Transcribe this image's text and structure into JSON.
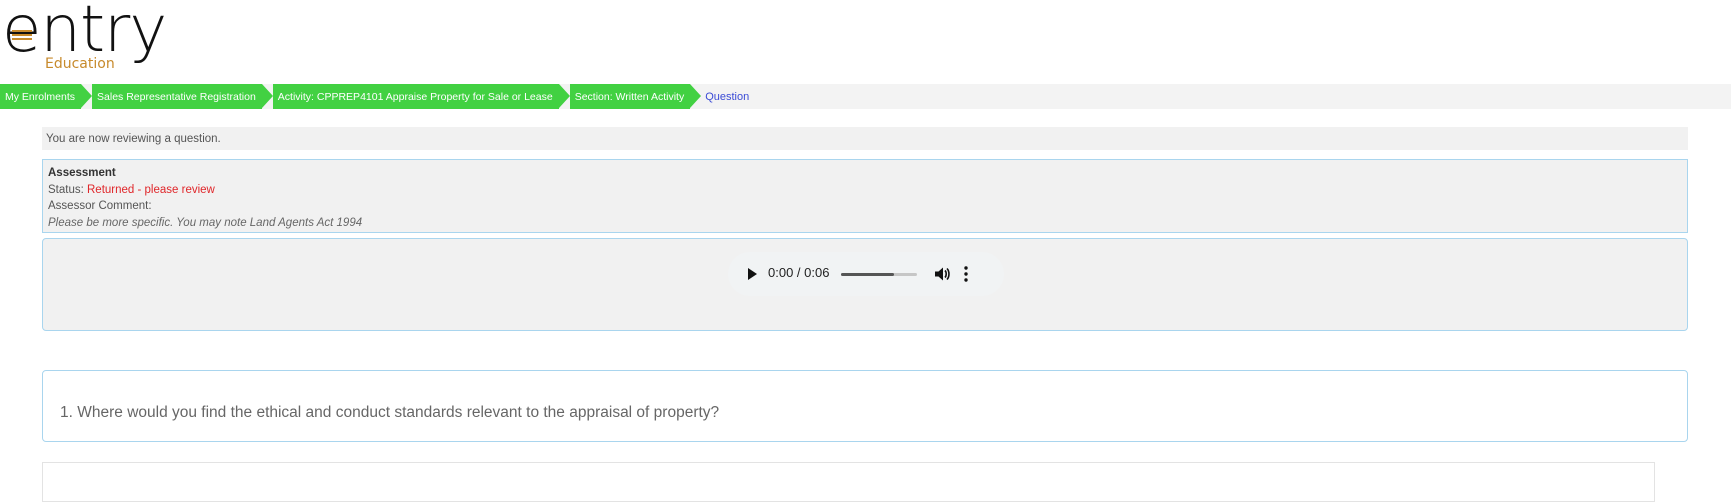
{
  "logo": {
    "word": "entry",
    "sub": "Education"
  },
  "breadcrumb": {
    "items": [
      "My Enrolments",
      "Sales Representative Registration",
      "Activity: CPPREP4101 Appraise Property for Sale or Lease",
      "Section: Written Activity"
    ],
    "current": "Question"
  },
  "notice": "You are now reviewing a question.",
  "assessment": {
    "heading": "Assessment",
    "status_label": "Status: ",
    "status_value": "Returned - please review",
    "comment_label": "Assessor Comment:",
    "comment": "Please be more specific. You may note Land Agents Act 1994"
  },
  "audio": {
    "time": "0:00 / 0:06",
    "progress_fraction": 0.7
  },
  "question": {
    "text": "1. Where would you find the ethical and conduct standards relevant to the appraisal of property?"
  },
  "colors": {
    "breadcrumb_green": "#42d142",
    "current_blue": "#3b4bd6",
    "status_red": "#e0262a",
    "panel_border": "#a9d5ee",
    "logo_sub": "#c78a2b"
  }
}
